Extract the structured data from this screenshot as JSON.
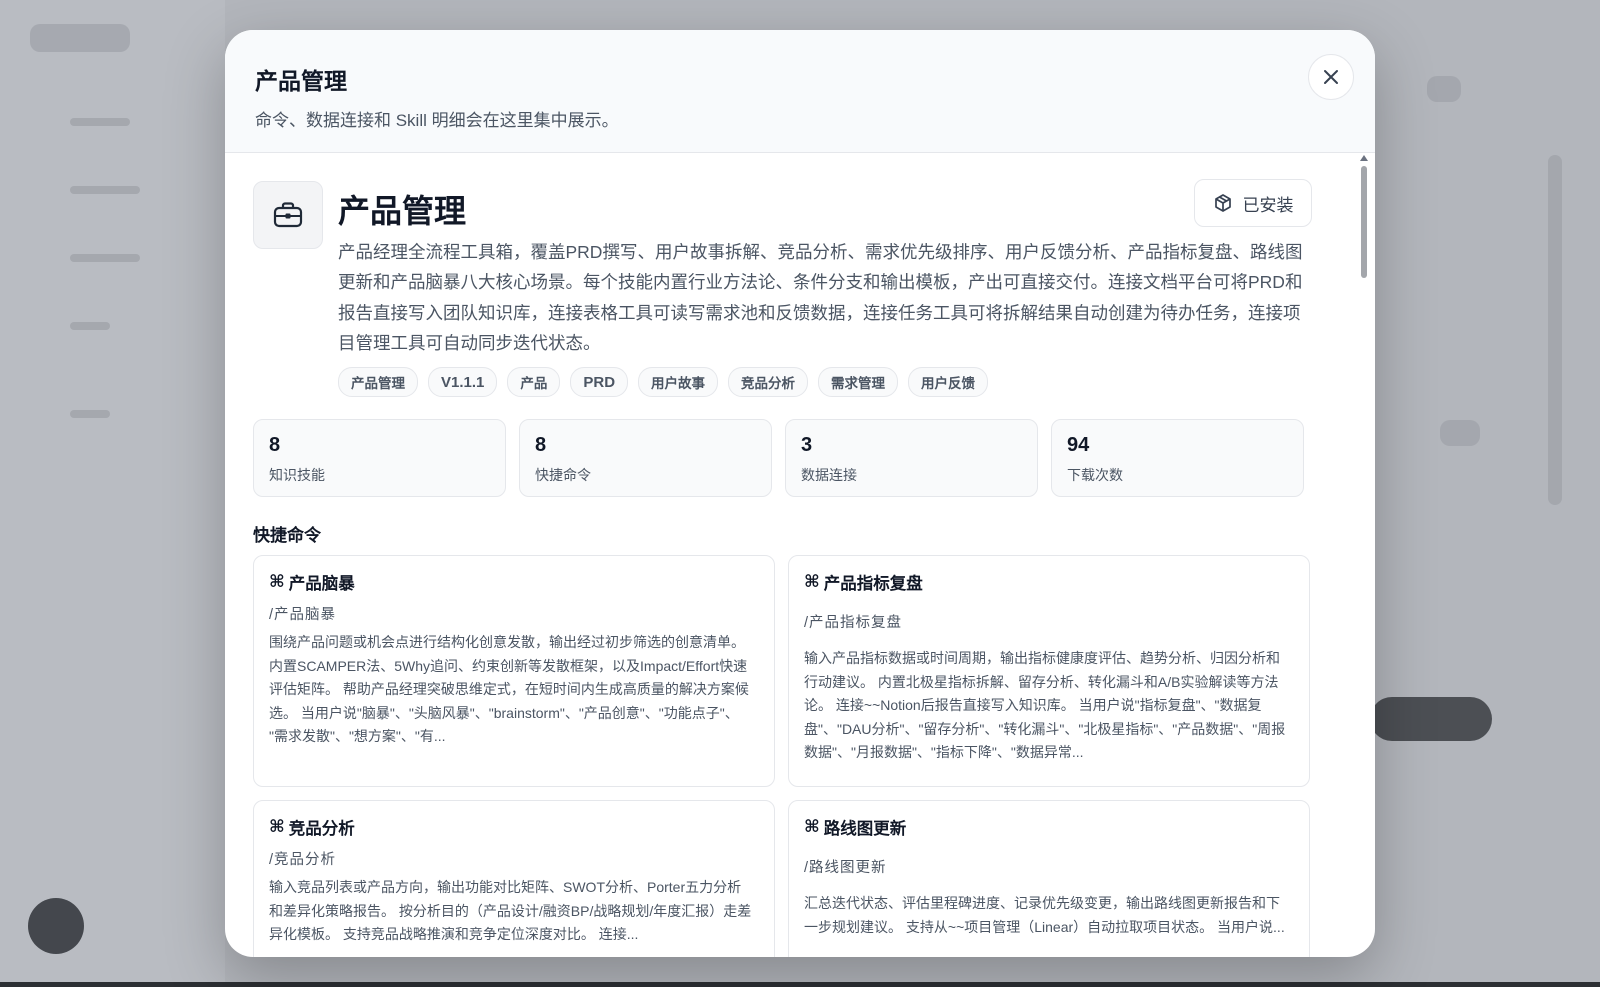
{
  "modal": {
    "title": "产品管理",
    "subtitle": "命令、数据连接和 Skill 明细会在这里集中展示。"
  },
  "plugin": {
    "icon": "briefcase-icon",
    "name": "产品管理",
    "installed_label": "已安装",
    "installed_icon": "package-icon",
    "description": "产品经理全流程工具箱，覆盖PRD撰写、用户故事拆解、竞品分析、需求优先级排序、用户反馈分析、产品指标复盘、路线图更新和产品脑暴八大核心场景。每个技能内置行业方法论、条件分支和输出模板，产出可直接交付。连接文档平台可将PRD和报告直接写入团队知识库，连接表格工具可读写需求池和反馈数据，连接任务工具可将拆解结果自动创建为待办任务，连接项目管理工具可自动同步迭代状态。",
    "tags": [
      "产品管理",
      "V1.1.1",
      "产品",
      "PRD",
      "用户故事",
      "竞品分析",
      "需求管理",
      "用户反馈"
    ]
  },
  "stats": [
    {
      "value": "8",
      "label": "知识技能"
    },
    {
      "value": "8",
      "label": "快捷命令"
    },
    {
      "value": "3",
      "label": "数据连接"
    },
    {
      "value": "94",
      "label": "下载次数"
    }
  ],
  "section_title": "快捷命令",
  "commands": [
    {
      "glyph": "⌘",
      "name": "产品脑暴",
      "command": "/产品脑暴",
      "description": "围绕产品问题或机会点进行结构化创意发散，输出经过初步筛选的创意清单。 内置SCAMPER法、5Why追问、约束创新等发散框架，以及Impact/Effort快速评估矩阵。 帮助产品经理突破思维定式，在短时间内生成高质量的解决方案候选。 当用户说\"脑暴\"、\"头脑风暴\"、\"brainstorm\"、\"产品创意\"、\"功能点子\"、 \"需求发散\"、\"想方案\"、\"有..."
    },
    {
      "glyph": "⌘",
      "name": "产品指标复盘",
      "command": "/产品指标复盘",
      "description": "输入产品指标数据或时间周期，输出指标健康度评估、趋势分析、归因分析和行动建议。 内置北极星指标拆解、留存分析、转化漏斗和A/B实验解读等方法论。 连接~~Notion后报告直接写入知识库。 当用户说\"指标复盘\"、\"数据复盘\"、\"DAU分析\"、\"留存分析\"、\"转化漏斗\"、\"北极星指标\"、\"产品数据\"、\"周报数据\"、\"月报数据\"、\"指标下降\"、\"数据异常..."
    },
    {
      "glyph": "⌘",
      "name": "竞品分析",
      "command": "/竞品分析",
      "description": "输入竞品列表或产品方向，输出功能对比矩阵、SWOT分析、Porter五力分析和差异化策略报告。 按分析目的（产品设计/融资BP/战略规划/年度汇报）走差异化模板。 支持竞品战略推演和竞争定位深度对比。 连接..."
    },
    {
      "glyph": "⌘",
      "name": "路线图更新",
      "command": "/路线图更新",
      "description": "汇总迭代状态、评估里程碑进度、记录优先级变更，输出路线图更新报告和下一步规划建议。 支持从~~项目管理（Linear）自动拉取项目状态。 当用户说..."
    }
  ]
}
